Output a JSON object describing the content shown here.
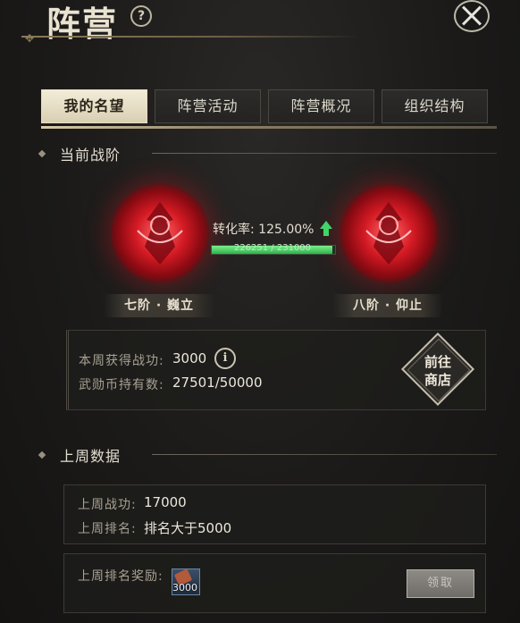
{
  "window": {
    "title": "阵营"
  },
  "tabs": [
    {
      "label": "我的名望",
      "active": true
    },
    {
      "label": "阵营活动",
      "active": false
    },
    {
      "label": "阵营概况",
      "active": false
    },
    {
      "label": "组织结构",
      "active": false
    }
  ],
  "current_rank": {
    "section_title": "当前战阶",
    "conversion_label": "转化率:",
    "conversion_rate": "125.00%",
    "progress_text": "226251 / 231000",
    "progress_fraction": 0.979,
    "current_rank_label": "七阶 · 巍立",
    "next_rank_label": "八阶 · 仰止"
  },
  "weekly": {
    "earned_label": "本周获得战功:",
    "earned_value": "3000",
    "coins_label": "武勋币持有数:",
    "coins_value": "27501/50000",
    "shop_button_line1": "前往",
    "shop_button_line2": "商店"
  },
  "last_week": {
    "section_title": "上周数据",
    "merit_label": "上周战功:",
    "merit_value": "17000",
    "rank_label": "上周排名:",
    "rank_value": "排名大于5000",
    "reward_label": "上周排名奖励:",
    "reward_count": "3000",
    "claim_label": "领取"
  },
  "colors": {
    "accent": "#d41a24",
    "progress": "#42d46a",
    "tab_active": "#ece3c8"
  },
  "icons": [
    "help-icon",
    "close-icon",
    "info-icon",
    "reward-scroll-icon",
    "faction-emblem-icon",
    "up-arrow-icon"
  ]
}
